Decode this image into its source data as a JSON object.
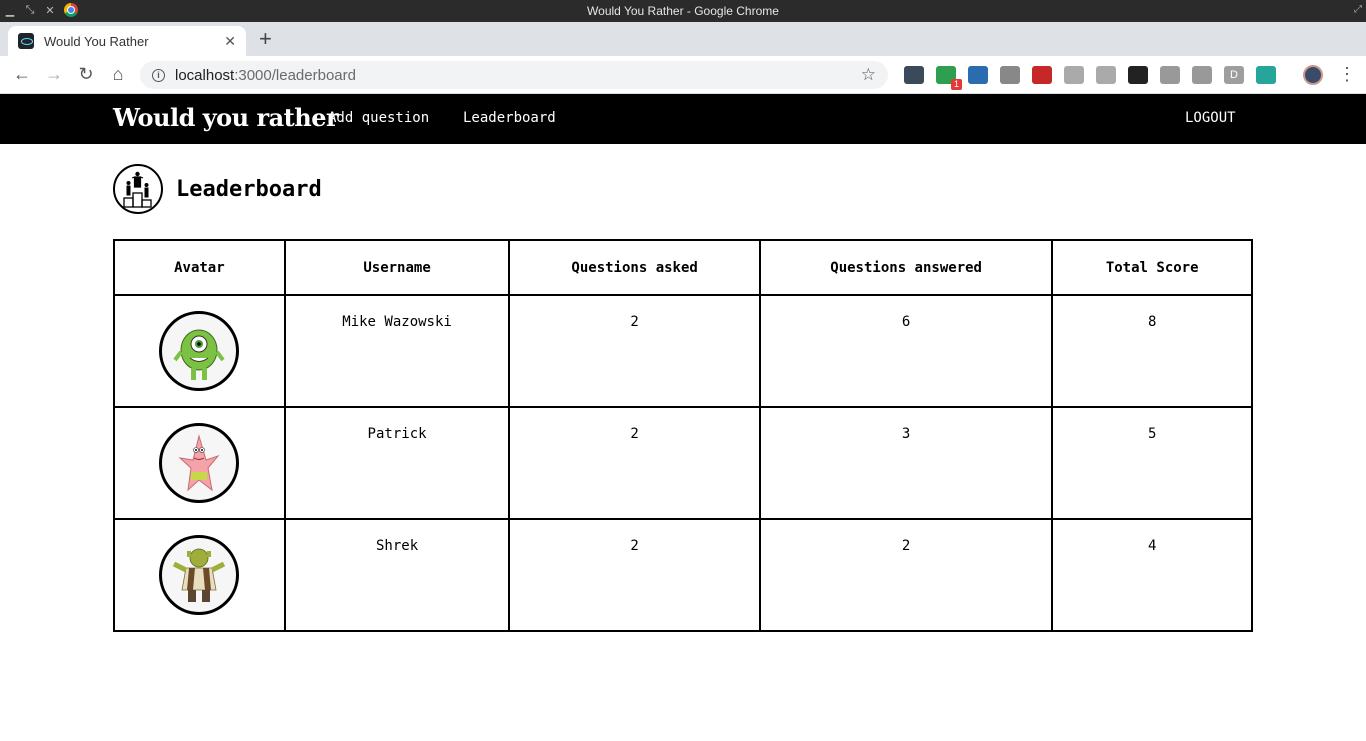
{
  "window": {
    "title": "Would You Rather - Google Chrome"
  },
  "tab": {
    "title": "Would You Rather",
    "close_glyph": "✕",
    "new_tab_glyph": "+"
  },
  "toolbar": {
    "url_host": "localhost",
    "url_path": ":3000/leaderboard",
    "extensions": [
      {
        "icon": "wordpress-extension-icon",
        "color": "#3b4a5a"
      },
      {
        "icon": "green-extension-icon",
        "color": "#2e9e4f",
        "badge": "1"
      },
      {
        "icon": "blue-extension-icon",
        "color": "#2b6cb0"
      },
      {
        "icon": "arrows-extension-icon",
        "color": "#888"
      },
      {
        "icon": "red-extension-icon",
        "color": "#c62828"
      },
      {
        "icon": "tree-extension-icon",
        "color": "#aaa"
      },
      {
        "icon": "gray-extension-icon",
        "color": "#aaa"
      },
      {
        "icon": "github-extension-icon",
        "color": "#222"
      },
      {
        "icon": "person-extension-icon",
        "color": "#999"
      },
      {
        "icon": "box-extension-icon",
        "color": "#999"
      },
      {
        "icon": "d-extension-icon",
        "color": "#9e9e9e",
        "label": "D"
      },
      {
        "icon": "teal-extension-icon",
        "color": "#26a69a"
      }
    ]
  },
  "app": {
    "brand": "Would you rather",
    "nav": {
      "add_question": "Add question",
      "leaderboard": "Leaderboard",
      "logout": "LOGOUT"
    },
    "page_title": "Leaderboard"
  },
  "leaderboard": {
    "headers": [
      "Avatar",
      "Username",
      "Questions asked",
      "Questions answered",
      "Total Score"
    ],
    "rows": [
      {
        "avatar": "mike-wazowski-avatar",
        "username": "Mike Wazowski",
        "asked": "2",
        "answered": "6",
        "score": "8"
      },
      {
        "avatar": "patrick-avatar",
        "username": "Patrick",
        "asked": "2",
        "answered": "3",
        "score": "5"
      },
      {
        "avatar": "shrek-avatar",
        "username": "Shrek",
        "asked": "2",
        "answered": "2",
        "score": "4"
      }
    ]
  }
}
